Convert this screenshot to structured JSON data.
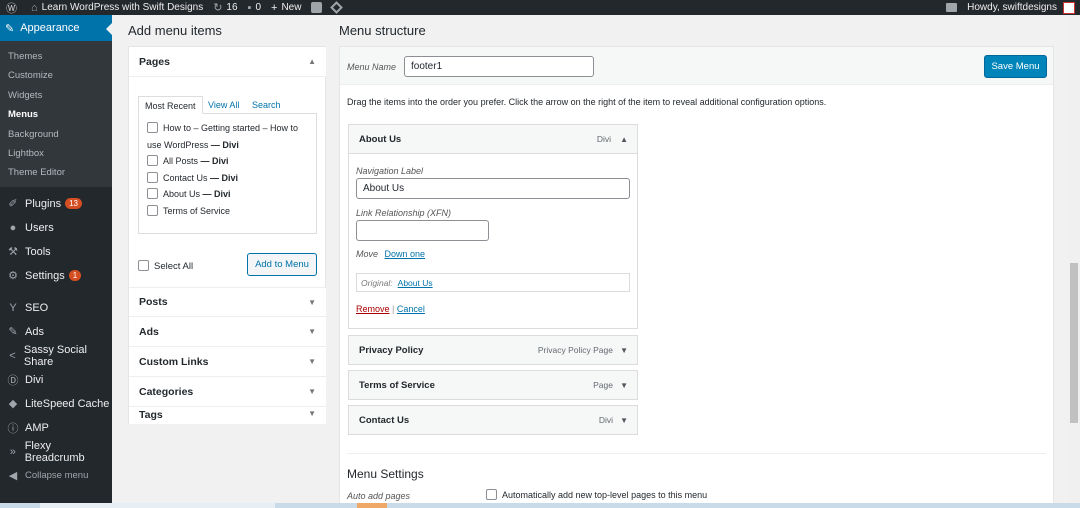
{
  "adminbar": {
    "site_title": "Learn WordPress with Swift Designs",
    "updates_count": "16",
    "comments_count": "0",
    "new_label": "New",
    "greeting": "Howdy, swiftdesigns"
  },
  "sidebar": {
    "current": "Appearance",
    "submenu": [
      "Themes",
      "Customize",
      "Widgets",
      "Menus",
      "Background",
      "Lightbox",
      "Theme Editor"
    ],
    "items": [
      {
        "label": "Plugins",
        "badge": "13",
        "icon": "plug-icon"
      },
      {
        "label": "Users",
        "badge": "",
        "icon": "user-icon"
      },
      {
        "label": "Tools",
        "badge": "",
        "icon": "wrench-icon"
      },
      {
        "label": "Settings",
        "badge": "1",
        "icon": "settings-icon"
      },
      {
        "label": "SEO",
        "badge": "",
        "icon": "yoast-icon"
      },
      {
        "label": "Ads",
        "badge": "",
        "icon": "pin-icon"
      },
      {
        "label": "Sassy Social Share",
        "badge": "",
        "icon": "share-icon"
      },
      {
        "label": "Divi",
        "badge": "",
        "icon": "divi-icon"
      },
      {
        "label": "LiteSpeed Cache",
        "badge": "",
        "icon": "diamond-icon"
      },
      {
        "label": "AMP",
        "badge": "",
        "icon": "amp-icon"
      },
      {
        "label": "Flexy Breadcrumb",
        "badge": "",
        "icon": "breadcrumb-icon"
      }
    ],
    "collapse": "Collapse menu"
  },
  "add_items": {
    "heading": "Add menu items",
    "pages_title": "Pages",
    "tabs": [
      "Most Recent",
      "View All",
      "Search"
    ],
    "pages": [
      {
        "title_line1": "How to – Getting started – How to",
        "title_line2": "use WordPress",
        "suffix": "— Divi"
      },
      {
        "title": "All Posts",
        "suffix": "— Divi"
      },
      {
        "title": "Contact Us",
        "suffix": "— Divi"
      },
      {
        "title": "About Us",
        "suffix": "— Divi"
      },
      {
        "title": "Terms of Service",
        "suffix": ""
      }
    ],
    "select_all": "Select All",
    "add_button": "Add to Menu",
    "sections": [
      "Posts",
      "Ads",
      "Custom Links",
      "Categories",
      "Tags"
    ]
  },
  "structure": {
    "heading": "Menu structure",
    "menu_name_label": "Menu Name",
    "menu_name_value": "footer1",
    "save_button": "Save Menu",
    "instructions": "Drag the items into the order you prefer. Click the arrow on the right of the item to reveal additional configuration options.",
    "expanded_item": {
      "title": "About Us",
      "type": "Divi",
      "nav_label_caption": "Navigation Label",
      "nav_label_value": "About Us",
      "xfn_caption": "Link Relationship (XFN)",
      "xfn_value": "",
      "move_label": "Move",
      "move_link": "Down one",
      "original_label": "Original:",
      "original_link": "About Us",
      "remove": "Remove",
      "separator": "|",
      "cancel": "Cancel"
    },
    "items": [
      {
        "title": "Privacy Policy",
        "type": "Privacy Policy Page"
      },
      {
        "title": "Terms of Service",
        "type": "Page"
      },
      {
        "title": "Contact Us",
        "type": "Divi"
      }
    ],
    "settings_heading": "Menu Settings",
    "auto_add_label": "Auto add pages",
    "auto_add_text": "Automatically add new top-level pages to this menu"
  },
  "colors": {
    "accent": "#0073aa",
    "admin_dark": "#23282d",
    "primary_button": "#0085ba",
    "badge": "#d54e21"
  }
}
